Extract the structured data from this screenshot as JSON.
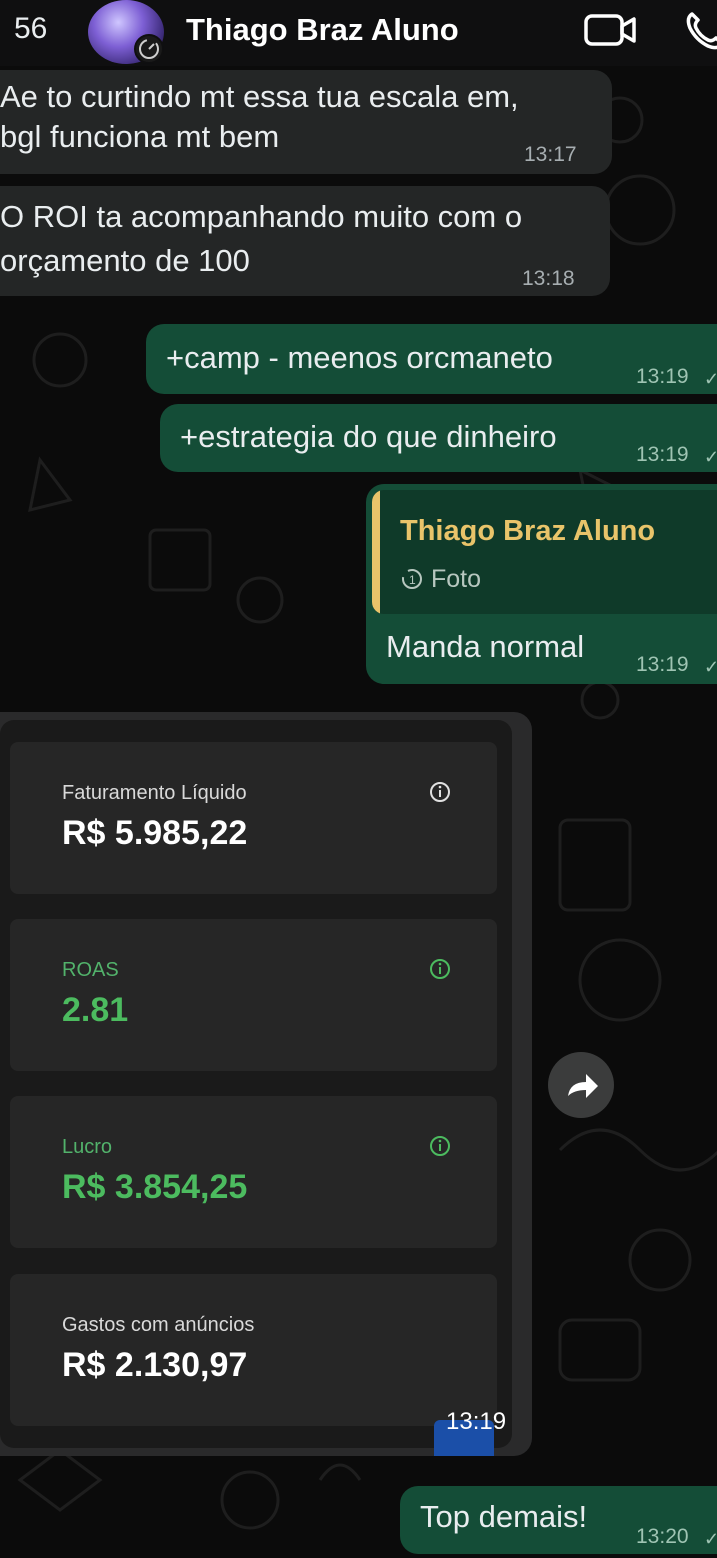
{
  "header": {
    "back_count": "56",
    "contact_name": "Thiago Braz Aluno",
    "icons": [
      "video-call-icon",
      "voice-call-icon",
      "status-ring-icon"
    ]
  },
  "messages": [
    {
      "direction": "incoming",
      "lines": [
        "Ae to curtindo mt essa tua escala em,",
        "bgl funciona mt bem"
      ],
      "time": "13:17"
    },
    {
      "direction": "incoming",
      "lines": [
        "O ROI ta acompanhando muito com o",
        "orçamento de 100"
      ],
      "time": "13:18"
    },
    {
      "direction": "outgoing",
      "text": "+camp - meenos orcmaneto",
      "time": "13:19"
    },
    {
      "direction": "outgoing",
      "text": "+estrategia do que dinheiro",
      "time": "13:19"
    },
    {
      "direction": "outgoing",
      "reply_author": "Thiago Braz Aluno",
      "reply_type": "Foto",
      "text": "Manda normal",
      "time": "13:19"
    },
    {
      "direction": "incoming",
      "type": "photo",
      "time": "13:19"
    },
    {
      "direction": "outgoing",
      "text": "Top demais!",
      "time": "13:20"
    }
  ],
  "dashboard": {
    "cards": [
      {
        "label": "Faturamento Líquido",
        "value": "R$ 5.985,22",
        "color": "#ffffff"
      },
      {
        "label": "ROAS",
        "value": "2.81",
        "color": "#4cbb5f"
      },
      {
        "label": "Lucro",
        "value": "R$ 3.854,25",
        "color": "#4cbb5f"
      },
      {
        "label": "Gastos com anúncios",
        "value": "R$ 2.130,97",
        "color": "#ffffff"
      }
    ]
  },
  "colors": {
    "incoming_bubble": "#242626",
    "outgoing_bubble": "#144d37",
    "reply_accent": "#e9c46a"
  }
}
